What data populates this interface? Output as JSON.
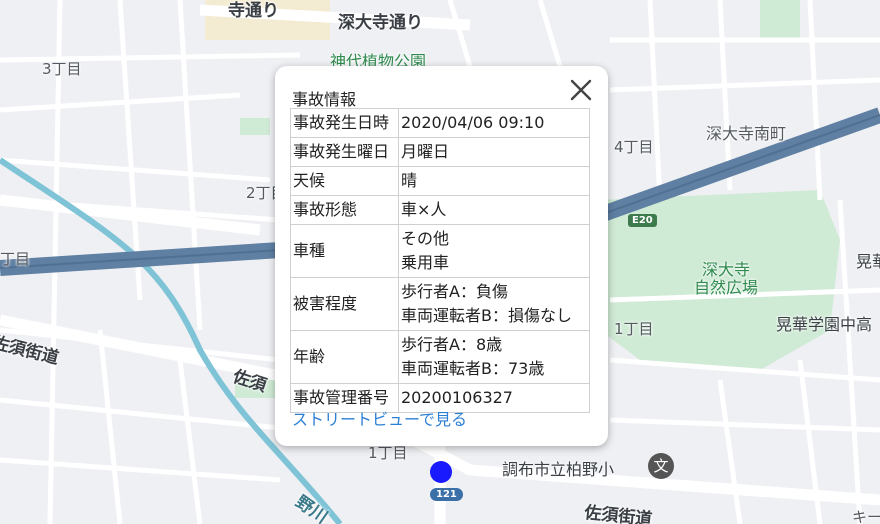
{
  "map": {
    "labels": {
      "jindaiji_dori_1": "寺通り",
      "jindaiji_dori_2": "深大寺通り",
      "park": "神代植物公園",
      "district_3": "3丁目",
      "district_4": "4丁目",
      "jindaiji_minamimachi": "深大寺南町",
      "district_2": "2丁目",
      "district_edge": "丁目",
      "district_1": "1丁目",
      "district_1_bottom": "1丁目",
      "nature_park_1": "深大寺",
      "nature_park_2": "自然広場",
      "koka_edge": "晃華",
      "koka_school": "晃華学園中高",
      "sasu_kaido_1": "佐須街道",
      "sasu_kaido_2": "佐須",
      "sasu_kaido_3": "佐須街道",
      "school": "調布市立柏野小",
      "noga": "野川",
      "kii": "キー"
    },
    "shields": {
      "expressway": "E20",
      "route": "121"
    },
    "school_icon": "文"
  },
  "popup": {
    "title": "事故情報",
    "close_icon": "close-icon",
    "rows": [
      {
        "key": "事故発生日時",
        "lines": [
          "2020/04/06 09:10"
        ]
      },
      {
        "key": "事故発生曜日",
        "lines": [
          "月曜日"
        ]
      },
      {
        "key": "天候",
        "lines": [
          "晴"
        ]
      },
      {
        "key": "事故形態",
        "lines": [
          "車×人"
        ]
      },
      {
        "key": "車種",
        "lines": [
          "その他",
          "乗用車"
        ]
      },
      {
        "key": "被害程度",
        "lines": [
          "歩行者A：負傷",
          "車両運転者B：損傷なし"
        ]
      },
      {
        "key": "年齢",
        "lines": [
          "歩行者A：8歳",
          "車両運転者B：73歳"
        ]
      },
      {
        "key": "事故管理番号",
        "lines": [
          "20200106327"
        ]
      }
    ],
    "street_view_link": "ストリートビューで見る"
  },
  "colors": {
    "map_bg": "#eef0f3",
    "road": "#ffffff",
    "expressway": "#5f7fa3",
    "park": "#cfead5",
    "river": "#7fc3d6",
    "marker": "#1a1aff",
    "link": "#2b7fd6"
  }
}
